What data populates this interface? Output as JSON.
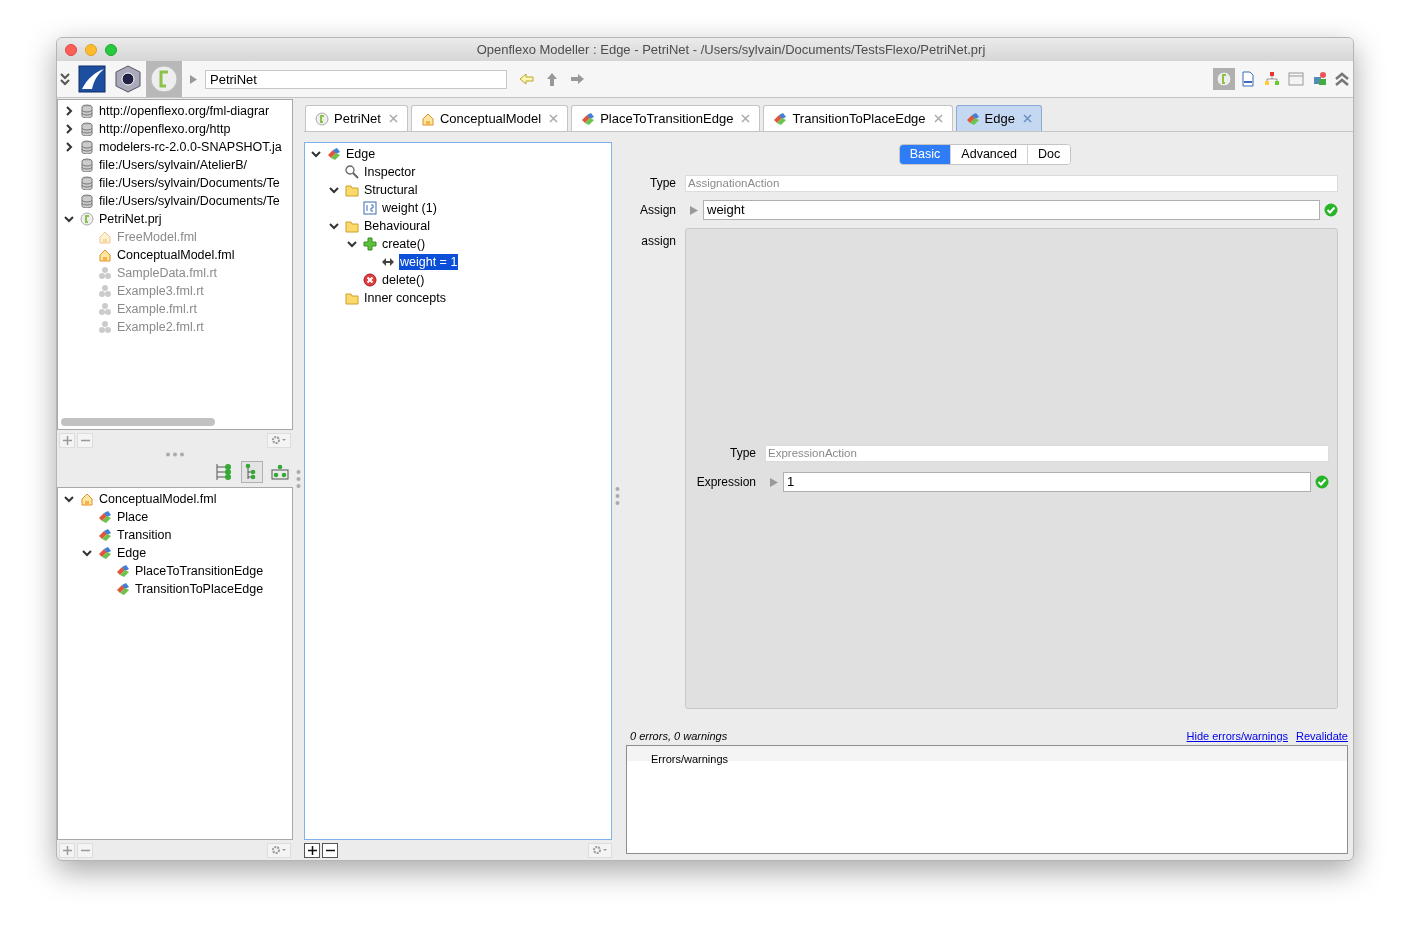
{
  "window": {
    "title": "Openflexo Modeller : Edge - PetriNet - /Users/sylvain/Documents/TestsFlexo/PetriNet.prj"
  },
  "toolbar": {
    "modules": [
      {
        "kind": "wing",
        "selected": false
      },
      {
        "kind": "cube",
        "selected": false
      },
      {
        "kind": "project",
        "selected": true
      }
    ],
    "breadcrumb": "PetriNet",
    "perspectives": [
      {
        "kind": "project",
        "selected": true
      },
      {
        "kind": "fml",
        "selected": false
      },
      {
        "kind": "hierarchy",
        "selected": false
      },
      {
        "kind": "window",
        "selected": false
      },
      {
        "kind": "palette",
        "selected": false
      }
    ]
  },
  "resource_tree": {
    "buttons_enabled": false,
    "items": [
      {
        "label": "http://openflexo.org/fml-diagrar",
        "kind": "database",
        "expanded": false
      },
      {
        "label": "http://openflexo.org/http",
        "kind": "database",
        "expanded": false
      },
      {
        "label": "modelers-rc-2.0.0-SNAPSHOT.ja",
        "kind": "database",
        "expanded": false
      },
      {
        "label": "file:/Users/sylvain/AtelierB/",
        "kind": "database"
      },
      {
        "label": "file:/Users/sylvain/Documents/Te",
        "kind": "database"
      },
      {
        "label": "file:/Users/sylvain/Documents/Te",
        "kind": "database"
      },
      {
        "label": "PetriNet.prj",
        "kind": "project",
        "expanded": true,
        "children": [
          {
            "label": "FreeModel.fml",
            "kind": "fml",
            "disabled": true
          },
          {
            "label": "ConceptualModel.fml",
            "kind": "fml",
            "disabled": false
          },
          {
            "label": "SampleData.fml.rt",
            "kind": "runtime",
            "disabled": true
          },
          {
            "label": "Example3.fml.rt",
            "kind": "runtime",
            "disabled": true
          },
          {
            "label": "Example.fml.rt",
            "kind": "runtime",
            "disabled": true
          },
          {
            "label": "Example2.fml.rt",
            "kind": "runtime",
            "disabled": true
          }
        ]
      }
    ]
  },
  "view_modes": [
    {
      "kind": "list",
      "selected": false
    },
    {
      "kind": "tree",
      "selected": true
    },
    {
      "kind": "org",
      "selected": false
    }
  ],
  "concept_tree": {
    "buttons_enabled": false,
    "items": [
      {
        "label": "ConceptualModel.fml",
        "kind": "fml",
        "expanded": true,
        "children": [
          {
            "label": "Place",
            "kind": "concept"
          },
          {
            "label": "Transition",
            "kind": "concept"
          },
          {
            "label": "Edge",
            "kind": "concept",
            "expanded": true,
            "children": [
              {
                "label": "PlaceToTransitionEdge",
                "kind": "concept"
              },
              {
                "label": "TransitionToPlaceEdge",
                "kind": "concept"
              }
            ]
          }
        ]
      }
    ]
  },
  "tabs": [
    {
      "label": "PetriNet",
      "kind": "project",
      "selected": false
    },
    {
      "label": "ConceptualModel",
      "kind": "fml",
      "selected": false
    },
    {
      "label": "PlaceToTransitionEdge",
      "kind": "concept",
      "selected": false
    },
    {
      "label": "TransitionToPlaceEdge",
      "kind": "concept",
      "selected": false
    },
    {
      "label": "Edge",
      "kind": "concept",
      "selected": true
    }
  ],
  "structure_tree": {
    "buttons_enabled": true,
    "items": [
      {
        "label": "Edge",
        "kind": "concept",
        "expanded": true,
        "selected": false,
        "children": [
          {
            "label": "Inspector",
            "kind": "search",
            "selected": false
          },
          {
            "label": "Structural",
            "kind": "folder",
            "expanded": true,
            "selected": false,
            "children": [
              {
                "label": "weight (1)",
                "kind": "integer",
                "selected": false
              }
            ]
          },
          {
            "label": "Behavioural",
            "kind": "folder",
            "expanded": true,
            "selected": false,
            "children": [
              {
                "label": "create()",
                "kind": "plus",
                "expanded": true,
                "selected": false,
                "children": [
                  {
                    "label": "weight = 1",
                    "kind": "assign",
                    "selected": true
                  }
                ]
              },
              {
                "label": "delete()",
                "kind": "delete",
                "selected": false
              }
            ]
          },
          {
            "label": "Inner concepts",
            "kind": "folder",
            "selected": false
          }
        ]
      }
    ]
  },
  "inspector": {
    "view_tabs": [
      {
        "label": "Basic",
        "selected": true
      },
      {
        "label": "Advanced",
        "selected": false
      },
      {
        "label": "Doc",
        "selected": false
      }
    ],
    "fields": [
      {
        "label": "Type",
        "kind": "readonly",
        "value": "AssignationAction"
      },
      {
        "label": "Assign",
        "kind": "binding",
        "value": "weight",
        "valid": true
      }
    ],
    "section_label": "assign",
    "nested_fields": [
      {
        "label": "Type",
        "kind": "readonly",
        "value": "ExpressionAction"
      },
      {
        "label": "Expression",
        "kind": "binding",
        "value": "1",
        "valid": true
      }
    ]
  },
  "validation": {
    "summary": "0 errors, 0 warnings",
    "links": [
      "Hide errors/warnings",
      "Revalidate"
    ],
    "column": "Errors/warnings"
  }
}
